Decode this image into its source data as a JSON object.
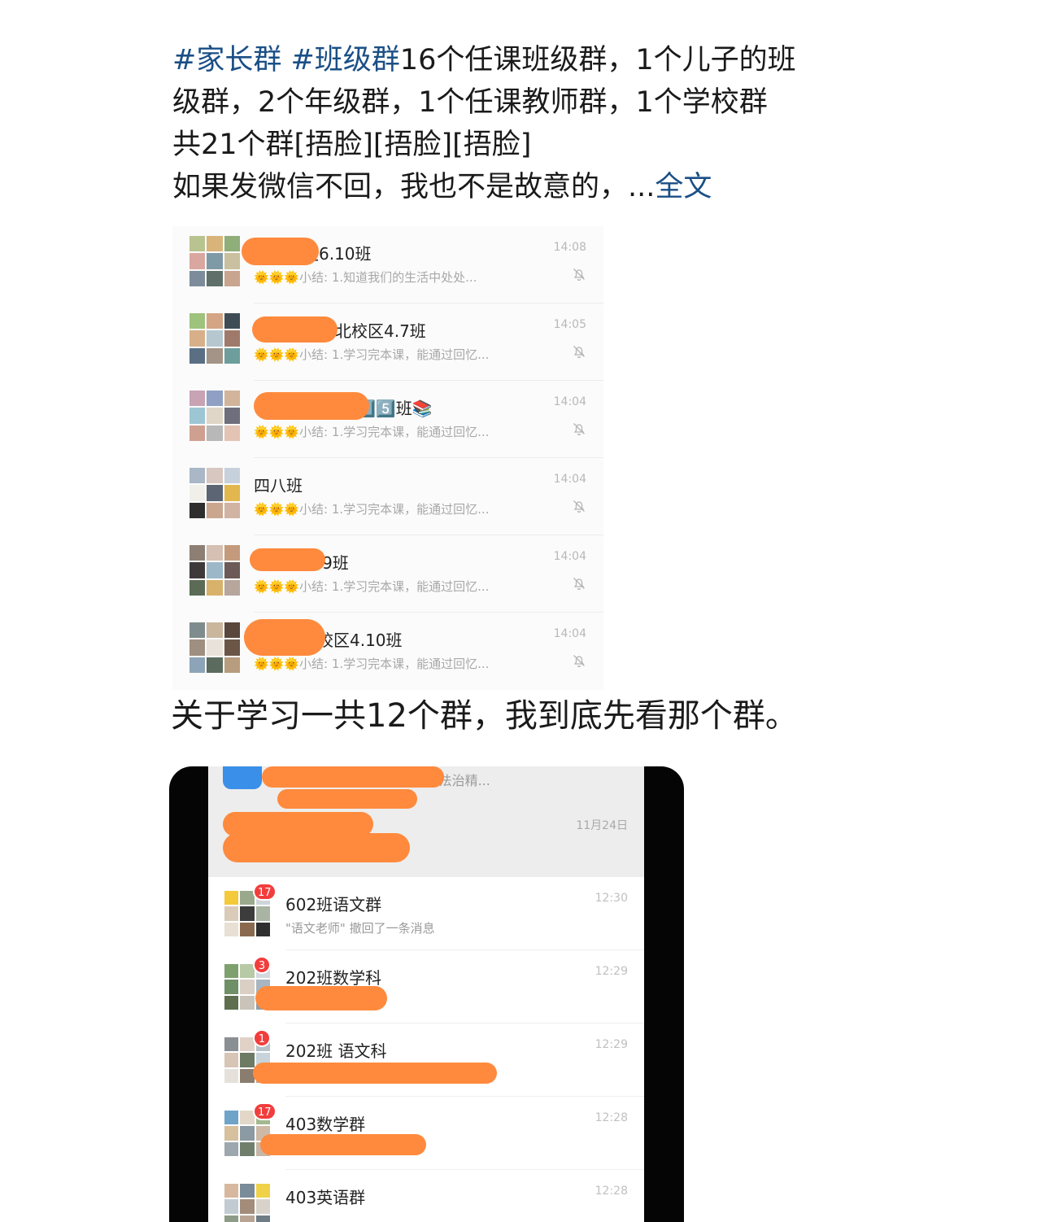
{
  "post": {
    "tag1": "#家长群",
    "tag2": "#班级群",
    "line1_text": "16个任课班级群，1个儿子的班",
    "line2": "级群，2个年级群，1个任课教师群，1个学校群",
    "line3": "共21个群[捂脸][捂脸][捂脸]",
    "line4": "如果发微信不回，我也不是故意的，...",
    "more_label": "全文"
  },
  "screenshot1": {
    "rows": [
      {
        "name": "小北校区6.10班",
        "emoji": "🌞🌞🌞",
        "preview": "小结:  1.知道我们的生活中处处...",
        "time": "14:08"
      },
      {
        "name": "北校区4.7班",
        "emoji": "🌞🌞🌞",
        "preview": "小结: 1.学习完本课，能通过回忆...",
        "time": "14:05"
      },
      {
        "name": "1️⃣5️⃣班📚",
        "emoji": "🌞🌞🌞",
        "preview": "小结: 1.学习完本课，能通过回忆...",
        "time": "14:04"
      },
      {
        "name": "四八班",
        "emoji": "🌞🌞🌞",
        "preview": "小结: 1.学习完本课，能通过回忆...",
        "time": "14:04"
      },
      {
        "name": "4.9班",
        "emoji": "🌞🌞🌞",
        "preview": "小结: 1.学习完本课，能通过回忆...",
        "time": "14:04"
      },
      {
        "name": "校区4.10班",
        "emoji": "🌞🌞🌞",
        "preview": "小结: 1.学习完本课，能通过回忆...",
        "time": "14:04"
      }
    ]
  },
  "caption": "关于学习一共12个群，我到底先看那个群。",
  "screenshot2": {
    "top_preview": "法宣传“六个一”，法治精...",
    "top_date": "11月24日",
    "groups": [
      {
        "name": "602班语文群",
        "preview": "\"语文老师\" 撤回了一条消息",
        "time": "12:30",
        "badge": "17"
      },
      {
        "name": "202班数学科",
        "preview": "",
        "time": "12:29",
        "badge": "3"
      },
      {
        "name": "202班 语文科",
        "preview": "",
        "time": "12:29",
        "badge": "1"
      },
      {
        "name": "403数学群",
        "preview": "",
        "time": "12:28",
        "badge": "17"
      },
      {
        "name": "403英语群",
        "preview": "",
        "time": "12:28",
        "badge": ""
      }
    ]
  },
  "colors": {
    "link": "#1a4f86",
    "redaction": "#ff8a3d",
    "badge": "#f23d3d"
  }
}
